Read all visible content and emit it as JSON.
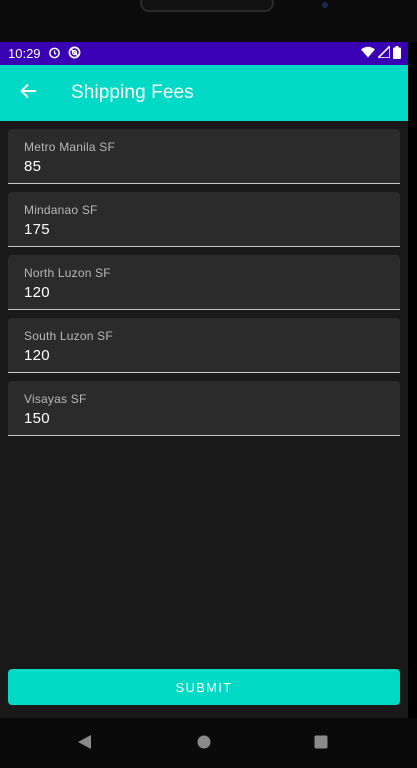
{
  "status_bar": {
    "time": "10:29",
    "left_icons": [
      "alarm-icon",
      "dnd-icon"
    ],
    "right_icons": [
      "wifi-icon",
      "signal-icon",
      "battery-icon"
    ],
    "color": "#3a00b4"
  },
  "app_bar": {
    "title": "Shipping Fees",
    "back_icon": "arrow-back-icon",
    "color": "#00d9c5"
  },
  "fields": [
    {
      "label": "Metro Manila SF",
      "value": "85"
    },
    {
      "label": "Mindanao SF",
      "value": "175"
    },
    {
      "label": "North Luzon SF",
      "value": "120"
    },
    {
      "label": "South Luzon SF",
      "value": "120"
    },
    {
      "label": "Visayas SF",
      "value": "150"
    }
  ],
  "submit": {
    "label": "SUBMIT",
    "color": "#00d9c5"
  },
  "nav_bar": {
    "icons": [
      "nav-back-icon",
      "nav-home-icon",
      "nav-recents-icon"
    ]
  }
}
